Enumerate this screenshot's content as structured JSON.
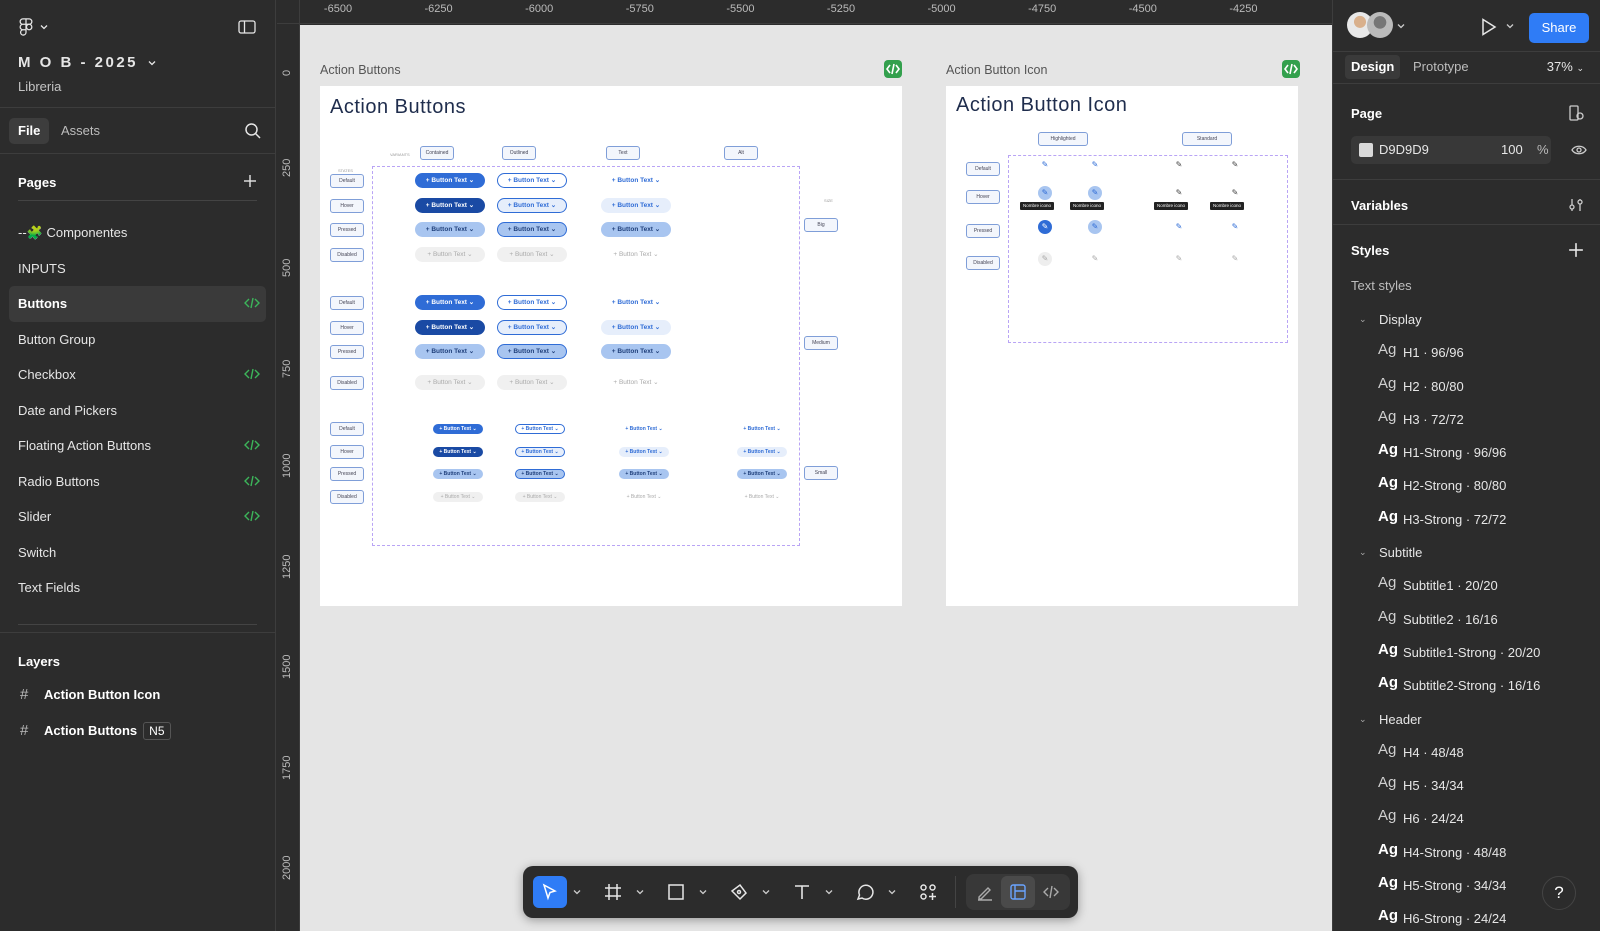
{
  "file": {
    "title": "M O B - 2025",
    "subtitle": "Libreria"
  },
  "left_tabs": {
    "file": "File",
    "assets": "Assets"
  },
  "pages": {
    "header": "Pages",
    "items": [
      {
        "label": "--🧩 Componentes",
        "code": false,
        "selected": false
      },
      {
        "label": "INPUTS",
        "code": false,
        "selected": false
      },
      {
        "label": "Buttons",
        "code": true,
        "selected": true
      },
      {
        "label": "Button Group",
        "code": false,
        "selected": false
      },
      {
        "label": "Checkbox",
        "code": true,
        "selected": false
      },
      {
        "label": "Date and Pickers",
        "code": false,
        "selected": false
      },
      {
        "label": "Floating Action Buttons",
        "code": true,
        "selected": false
      },
      {
        "label": "Radio Buttons",
        "code": true,
        "selected": false
      },
      {
        "label": "Slider",
        "code": true,
        "selected": false
      },
      {
        "label": "Switch",
        "code": false,
        "selected": false
      },
      {
        "label": "Text Fields",
        "code": false,
        "selected": false
      }
    ]
  },
  "layers": {
    "header": "Layers",
    "items": [
      {
        "label": "Action Button Icon",
        "badge": ""
      },
      {
        "label": "Action Buttons",
        "badge": "N5"
      }
    ]
  },
  "ruler": {
    "top": [
      "-6500",
      "-6250",
      "-6000",
      "-5750",
      "-5500",
      "-5250",
      "-5000",
      "-4750",
      "-4500",
      "-4250"
    ],
    "left": [
      "0",
      "250",
      "500",
      "750",
      "1000",
      "1250",
      "1500",
      "1750",
      "2000"
    ]
  },
  "canvas": {
    "frame1": {
      "label": "Action Buttons",
      "title": "Action Buttons",
      "variants_label": "VARIANTS",
      "states_label": "STATES",
      "size_label": "SIZE",
      "variants": [
        "Contained",
        "Outlined",
        "Text",
        "Alt"
      ],
      "states": [
        "Default",
        "Hover",
        "Pressed",
        "Disabled"
      ],
      "sizes": [
        "Big",
        "Medium",
        "Small"
      ],
      "button_text": "+ Button Text ⌄"
    },
    "frame2": {
      "label": "Action Button Icon",
      "title": "Action Button Icon",
      "columns": [
        "Highlighted",
        "Standard"
      ],
      "states": [
        "Default",
        "Hover",
        "Pressed",
        "Disabled"
      ],
      "tooltip": "Nombre icono"
    }
  },
  "right": {
    "share": "Share",
    "tabs": {
      "design": "Design",
      "prototype": "Prototype"
    },
    "zoom": "37%",
    "page_header": "Page",
    "page_color": "D9D9D9",
    "page_opacity": "100",
    "page_pct": "%",
    "variables": "Variables",
    "styles": "Styles",
    "text_styles": "Text styles",
    "groups": [
      {
        "name": "Display",
        "items": [
          {
            "label": "H1 · 96/96",
            "strong": false
          },
          {
            "label": "H2 · 80/80",
            "strong": false
          },
          {
            "label": "H3 · 72/72",
            "strong": false
          },
          {
            "label": "H1-Strong · 96/96",
            "strong": true
          },
          {
            "label": "H2-Strong · 80/80",
            "strong": true
          },
          {
            "label": "H3-Strong · 72/72",
            "strong": true
          }
        ]
      },
      {
        "name": "Subtitle",
        "items": [
          {
            "label": "Subtitle1 · 20/20",
            "strong": false
          },
          {
            "label": "Subtitle2 · 16/16",
            "strong": false
          },
          {
            "label": "Subtitle1-Strong · 20/20",
            "strong": true
          },
          {
            "label": "Subtitle2-Strong · 16/16",
            "strong": true
          }
        ]
      },
      {
        "name": "Header",
        "items": [
          {
            "label": "H4 · 48/48",
            "strong": false
          },
          {
            "label": "H5 · 34/34",
            "strong": false
          },
          {
            "label": "H6 · 24/24",
            "strong": false
          },
          {
            "label": "H4-Strong · 48/48",
            "strong": true
          },
          {
            "label": "H5-Strong · 34/34",
            "strong": true
          },
          {
            "label": "H6-Strong · 24/24",
            "strong": true
          }
        ]
      }
    ],
    "ag": "Ag",
    "help": "?"
  },
  "colors": {
    "accent": "#2f7cf6",
    "canvas": "#e5e5e5",
    "panel": "#2c2c2c",
    "code_badge": "#33a04d"
  }
}
